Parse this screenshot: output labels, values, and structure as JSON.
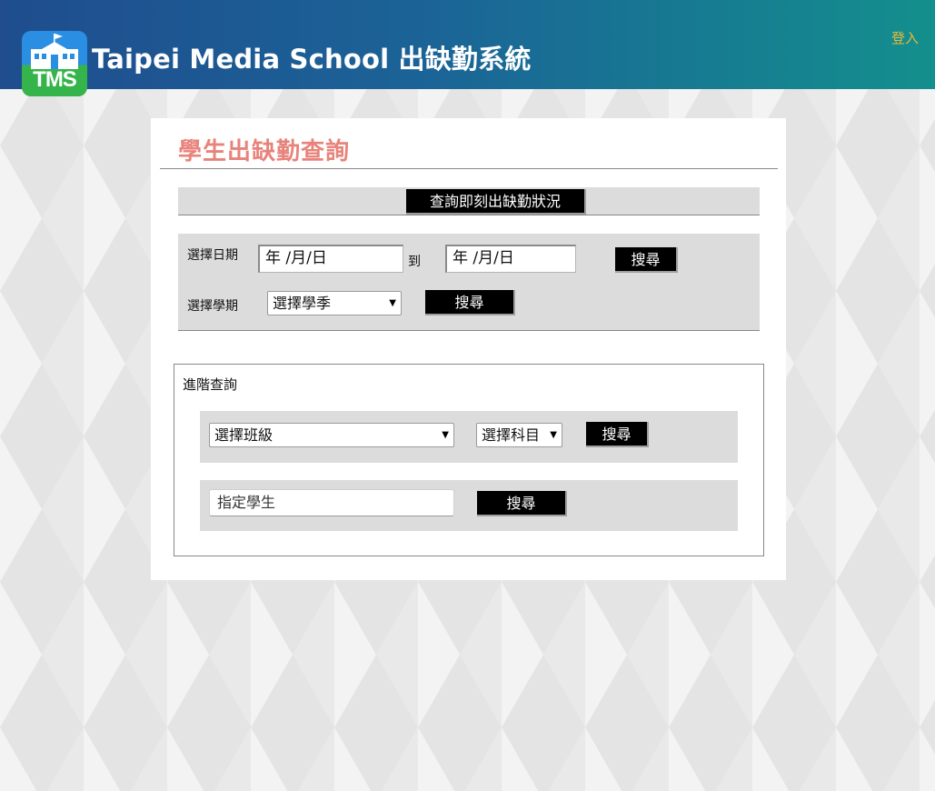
{
  "header": {
    "logo_text": "TMS",
    "title": "Taipei Media School 出缺勤系統",
    "login_label": "登入"
  },
  "page": {
    "title": "學生出缺勤查詢"
  },
  "realtime": {
    "button_label": "查詢即刻出缺勤狀況"
  },
  "date_search": {
    "date_label": "選擇日期",
    "start_placeholder": "年 /月/日",
    "to_label": "到",
    "end_placeholder": "年 /月/日",
    "search_label": "搜尋",
    "semester_label": "選擇學期",
    "semester_select": "選擇學季",
    "semester_search_label": "搜尋"
  },
  "advanced": {
    "title": "進階查詢",
    "class_select": "選擇班級",
    "subject_select": "選擇科目",
    "class_search_label": "搜尋",
    "student_placeholder": "指定學生",
    "student_search_label": "搜尋"
  },
  "colors": {
    "header_start": "#1f4d8e",
    "header_end": "#138f8d",
    "title_accent": "#e8837b",
    "login_link": "#e7b93a",
    "button_bg": "#000000"
  }
}
